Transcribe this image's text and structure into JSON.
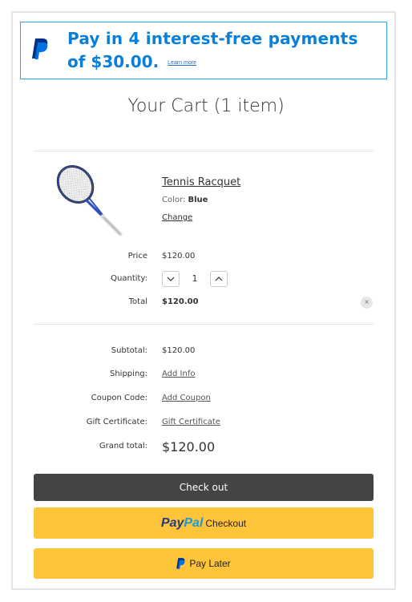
{
  "banner": {
    "line1": "Pay in 4 interest-free payments",
    "line2": "of $30.00.",
    "learn_more": "Learn more"
  },
  "cart": {
    "title": "Your Cart (1 item)"
  },
  "item": {
    "name": "Tennis Racquet",
    "color_label": "Color:",
    "color_value": "Blue",
    "change_label": "Change",
    "price_label": "Price",
    "price": "$120.00",
    "quantity_label": "Quantity:",
    "quantity": "1",
    "total_label": "Total",
    "total": "$120.00",
    "remove_symbol": "×"
  },
  "summary": {
    "subtotal_label": "Subtotal:",
    "subtotal": "$120.00",
    "shipping_label": "Shipping:",
    "shipping_link": "Add Info",
    "coupon_label": "Coupon Code:",
    "coupon_link": "Add Coupon",
    "gift_label": "Gift Certificate:",
    "gift_link": "Gift Certificate",
    "grand_label": "Grand total:",
    "grand_total": "$120.00"
  },
  "buttons": {
    "checkout": "Check out",
    "paypal_word_1": "Pay",
    "paypal_word_2": "Pal",
    "paypal_suffix": "Checkout",
    "pay_later": "Pay Later"
  },
  "colors": {
    "banner_text": "#0a7fd9",
    "banner_border": "#2ea3f2",
    "checkout_bg": "#444444",
    "paypal_bg": "#ffc439",
    "paypal_dark_blue": "#253b80",
    "paypal_light_blue": "#179bd7"
  },
  "icons": {
    "banner_logo": "paypal-logo-icon",
    "product_image": "tennis-racquet-image",
    "qty_decrease": "chevron-down-icon",
    "qty_increase": "chevron-up-icon",
    "remove": "close-icon",
    "paylater_logo": "paypal-logo-icon"
  }
}
